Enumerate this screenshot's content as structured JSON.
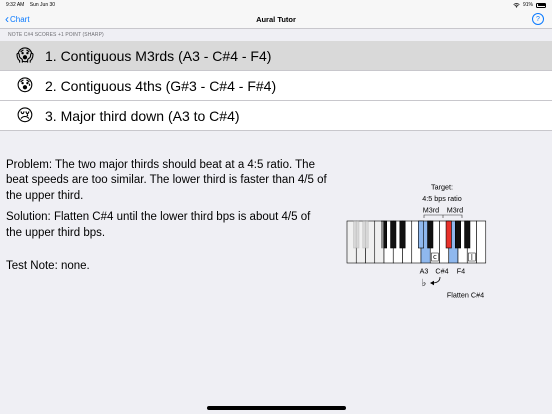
{
  "status_bar": {
    "time": "9:32 AM",
    "date": "Sun Jun 30",
    "battery": "91%",
    "icons": [
      "wifi-icon",
      "battery-icon"
    ]
  },
  "nav": {
    "back_label": "Chart",
    "title": "Aural Tutor",
    "help_label": "?"
  },
  "section_header": "NOTE C#4 SCORES +1 POINT (SHARP)",
  "items": [
    {
      "emoji": "😱",
      "emoji_name": "screaming-face-icon",
      "label": "1. Contiguous M3rds (A3 - C#4 - F4)",
      "selected": true
    },
    {
      "emoji": "😰",
      "emoji_name": "anxious-face-icon",
      "label": "2. Contiguous 4ths (G#3 - C#4 - F#4)",
      "selected": false
    },
    {
      "emoji": "😢",
      "emoji_name": "crying-face-icon",
      "label": "3. Major third down (A3 to C#4)",
      "selected": false
    }
  ],
  "content": {
    "problem": "Problem: The two major thirds should beat at a 4:5 ratio. The beat speeds are too similar. The lower third is faster than 4/5 of the upper third.",
    "solution": "Solution: Flatten C#4 until the lower third bps is about 4/5 of the upper third bps.",
    "test_note": "Test Note: none."
  },
  "diagram": {
    "target_label": "Target:",
    "ratio_label": "4:5 bps ratio",
    "interval_labels": [
      "M3rd",
      "M3rd"
    ],
    "note_labels": [
      "A3",
      "C#4",
      "F4"
    ],
    "action_label": "Flatten C#4",
    "colors": {
      "highlight_blue": "#8fb8ee",
      "highlight_red": "#e8312a",
      "grey_keys": "#c4c4c4"
    }
  },
  "colors": {
    "accent": "#0a7aff",
    "selected_row": "#d9d9d9",
    "background": "#efeff4"
  }
}
